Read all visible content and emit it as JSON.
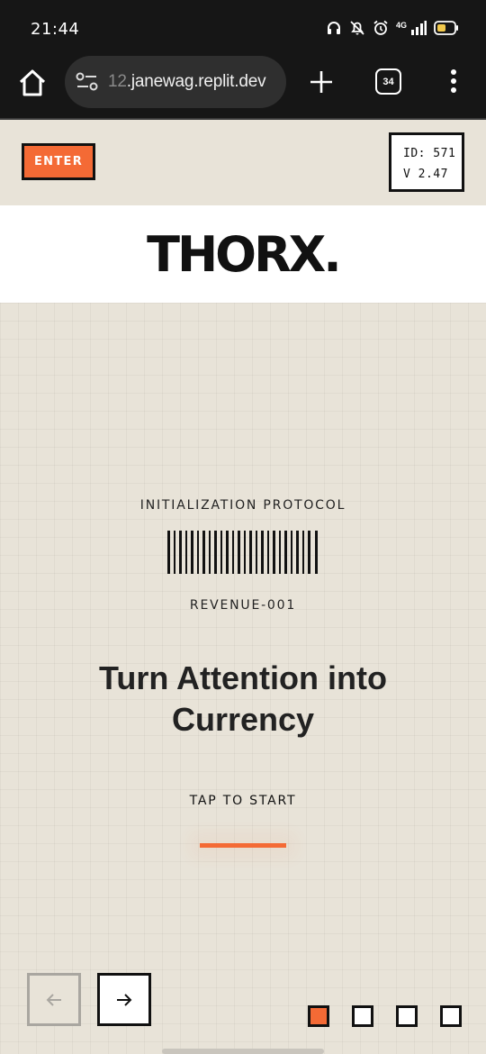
{
  "status_bar": {
    "time": "21:44",
    "network": "4G",
    "icons": [
      "headphones-icon",
      "bell-off-icon",
      "alarm-icon",
      "signal-icon",
      "battery-icon"
    ]
  },
  "browser": {
    "url_prefix": "12",
    "url_main": ".janewag.replit.dev",
    "tab_count": "34",
    "icons": [
      "home-icon",
      "site-settings-icon",
      "plus-icon",
      "tabs-icon",
      "more-vert-icon"
    ]
  },
  "page": {
    "enter_label": "ENTER",
    "id_line": "ID: 571",
    "version_line": "V 2.47",
    "logo": "THORX.",
    "protocol_label": "INITIALIZATION PROTOCOL",
    "revenue_label": "REVENUE-001",
    "headline": "Turn Attention into Currency",
    "tap_label": "TAP TO START",
    "pager": {
      "total": 4,
      "active_index": 0
    }
  },
  "colors": {
    "accent": "#f46a35",
    "background": "#e8e3d8",
    "ink": "#111111",
    "browser_chrome": "#161616"
  }
}
